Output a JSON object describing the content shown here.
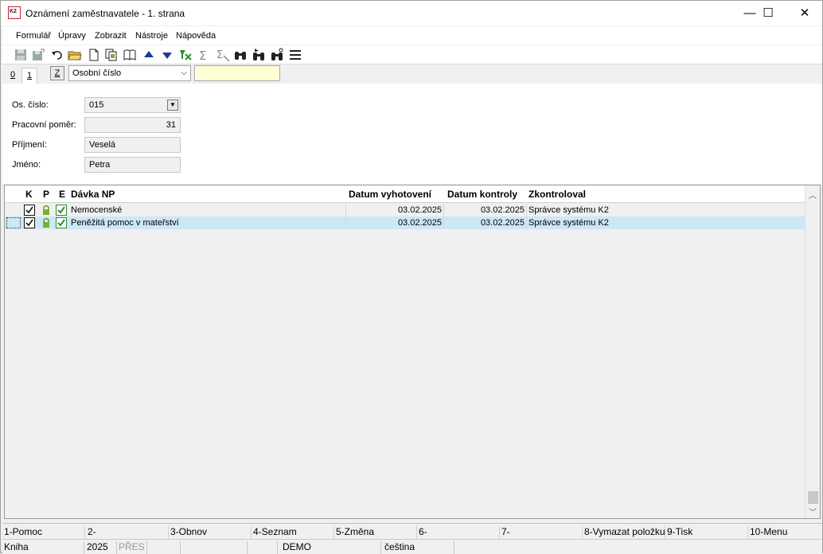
{
  "window": {
    "title": "Oznámení zaměstnavatele - 1. strana",
    "logo_text": "K2",
    "controls": {
      "minimize": "—",
      "maximize": "☐",
      "close": "✕"
    }
  },
  "menu": [
    {
      "label": "Formulář"
    },
    {
      "label": "Úpravy"
    },
    {
      "label": "Zobrazit"
    },
    {
      "label": "Nástroje"
    },
    {
      "label": "Nápověda"
    }
  ],
  "toolbar": {
    "icons": [
      "save-icon",
      "save-as-icon",
      "undo-icon",
      "open-folder-icon",
      "new-document-icon",
      "copy-icon",
      "book-icon",
      "arrow-up-icon",
      "arrow-down-icon",
      "filter-icon",
      "sum-icon",
      "sum-filter-icon",
      "binoculars-icon",
      "binoculars-next-icon",
      "binoculars-settings-icon",
      "menu-lines-icon"
    ]
  },
  "tabs": [
    {
      "label": "0",
      "active": false
    },
    {
      "label": "1",
      "active": true
    }
  ],
  "index_bar": {
    "z_button": "Z",
    "sort_select": "Osobní číslo",
    "search_value": ""
  },
  "form": {
    "os_cislo_label": "Os. číslo:",
    "os_cislo_value": "015",
    "pracovni_pomer_label": "Pracovní poměr:",
    "pracovni_pomer_value": "31",
    "prijmeni_label": "Příjmení:",
    "prijmeni_value": "Veselá",
    "jmeno_label": "Jméno:",
    "jmeno_value": "Petra"
  },
  "grid": {
    "headers": {
      "k": "K",
      "p": "P",
      "e": "E",
      "davka": "Dávka NP",
      "datum_vyhotoveni": "Datum vyhotovení",
      "datum_kontroly": "Datum kontroly",
      "zkontroloval": "Zkontroloval"
    },
    "rows": [
      {
        "davka": "Nemocenské",
        "datum_vyhotoveni": "03.02.2025",
        "datum_kontroly": "03.02.2025",
        "zkontroloval": "Správce systému K2",
        "selected": false
      },
      {
        "davka": "Peněžitá pomoc v mateřství",
        "datum_vyhotoveni": "03.02.2025",
        "datum_kontroly": "03.02.2025",
        "zkontroloval": "Správce systému K2",
        "selected": true
      }
    ]
  },
  "function_keys": [
    "1-Pomoc",
    "2-",
    "3-Obnov",
    "4-Seznam",
    "5-Změna",
    "6-",
    "7-",
    "8-Vymazat položku",
    "9-Tisk",
    "10-Menu"
  ],
  "status": {
    "book": "Kniha",
    "year": "2025",
    "mode": "PŘES",
    "company": "DEMO",
    "language": "čeština"
  },
  "colors": {
    "selected_row": "#cce8f4",
    "search_bg": "#ffffd6",
    "accent_green": "#2e8b2e"
  }
}
